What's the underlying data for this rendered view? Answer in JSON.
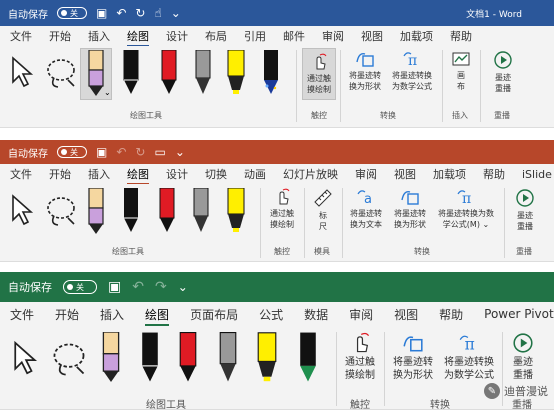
{
  "word": {
    "autosave_label": "自动保存",
    "autosave_state": "关",
    "doc_title": "文档1  -  Word",
    "tabs": [
      "文件",
      "开始",
      "插入",
      "绘图",
      "设计",
      "布局",
      "引用",
      "邮件",
      "审阅",
      "视图",
      "加载项",
      "帮助"
    ],
    "active_tab": "绘图",
    "groups": {
      "tools": "绘图工具",
      "touch": "触控",
      "convert": "转换",
      "insert": "插入",
      "replay": "重播"
    },
    "buttons": {
      "touch_draw": "通过触\n摸绘制",
      "ink_to_shape": "将墨迹转\n换为形状",
      "ink_to_math": "将墨迹转换\n为数学公式",
      "canvas": "画\n布",
      "ink_replay": "墨迹\n重播"
    },
    "accent": "#2b579a"
  },
  "powerpoint": {
    "autosave_label": "自动保存",
    "autosave_state": "关",
    "tabs": [
      "文件",
      "开始",
      "插入",
      "绘图",
      "设计",
      "切换",
      "动画",
      "幻灯片放映",
      "审阅",
      "视图",
      "加载项",
      "帮助",
      "iSlide"
    ],
    "active_tab": "绘图",
    "groups": {
      "tools": "绘图工具",
      "touch": "触控",
      "template": "模具",
      "convert": "转换",
      "replay": "重播"
    },
    "buttons": {
      "touch_draw": "通过触\n摸绘制",
      "ruler": "标\n尺",
      "ink_to_text": "将墨迹转\n换为文本",
      "ink_to_shape": "将墨迹转\n换为形状",
      "ink_to_math": "将墨迹转换为数\n学公式(M) ⌄",
      "ink_replay": "墨迹\n重播"
    },
    "accent": "#b7472a"
  },
  "excel": {
    "autosave_label": "自动保存",
    "autosave_state": "关",
    "tabs": [
      "文件",
      "开始",
      "插入",
      "绘图",
      "页面布局",
      "公式",
      "数据",
      "审阅",
      "视图",
      "帮助",
      "Power Pivot"
    ],
    "active_tab": "绘图",
    "groups": {
      "tools": "绘图工具",
      "touch": "触控",
      "convert": "转换",
      "replay": "重播"
    },
    "buttons": {
      "touch_draw": "通过触\n摸绘制",
      "ink_to_shape": "将墨迹转\n换为形状",
      "ink_to_math": "将墨迹转换\n为数学公式",
      "ink_replay": "墨迹\n重播"
    },
    "accent": "#217346"
  },
  "watermark": "迪普漫说",
  "icons": [
    "select-arrow-icon",
    "lasso-icon",
    "pencil-pink-icon",
    "pen-black-icon",
    "pen-red-icon",
    "pen-gray-icon",
    "highlighter-yellow-icon",
    "galaxy-pen-icon",
    "pen-green-icon",
    "touch-draw-icon",
    "ink-shape-icon",
    "ink-math-icon",
    "canvas-icon",
    "replay-icon",
    "ruler-icon",
    "ink-text-icon",
    "save-icon",
    "undo-icon",
    "redo-icon"
  ]
}
